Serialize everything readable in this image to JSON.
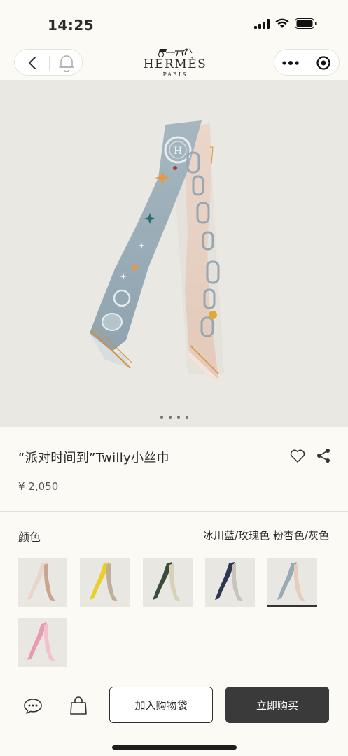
{
  "status_bar": {
    "time": "14:25"
  },
  "nav": {
    "logo_title": "HERMÈS",
    "logo_subtitle": "PARIS"
  },
  "gallery": {
    "image_count": 4,
    "active_index": 0
  },
  "product": {
    "title": "“派对时间到”Twilly小丝巾",
    "price": "¥ 2,050"
  },
  "color": {
    "label": "颜色",
    "selected_value": "冰川蓝/玫瑰色 粉杏色/灰色",
    "swatches": [
      {
        "name": "swatch-rose",
        "colors": [
          "#e8d4c8",
          "#c9a58f"
        ],
        "selected": false
      },
      {
        "name": "swatch-yellow",
        "colors": [
          "#e9cf2a",
          "#bfae9a"
        ],
        "selected": false
      },
      {
        "name": "swatch-dark-green",
        "colors": [
          "#3b4a3a",
          "#d8d1b8"
        ],
        "selected": false
      },
      {
        "name": "swatch-navy",
        "colors": [
          "#2d3750",
          "#c9c4bb"
        ],
        "selected": false
      },
      {
        "name": "swatch-blue-apricot",
        "colors": [
          "#97aab5",
          "#e5cdbc"
        ],
        "selected": true
      },
      {
        "name": "swatch-pink",
        "colors": [
          "#e99ab0",
          "#f2bfcc"
        ],
        "selected": false
      }
    ]
  },
  "actions": {
    "add_to_cart": "加入购物袋",
    "buy_now": "立即购买"
  },
  "colors": {
    "accent": "#3a3a3a",
    "background": "#fcfaf5",
    "hero_bg": "#eae8e3"
  }
}
